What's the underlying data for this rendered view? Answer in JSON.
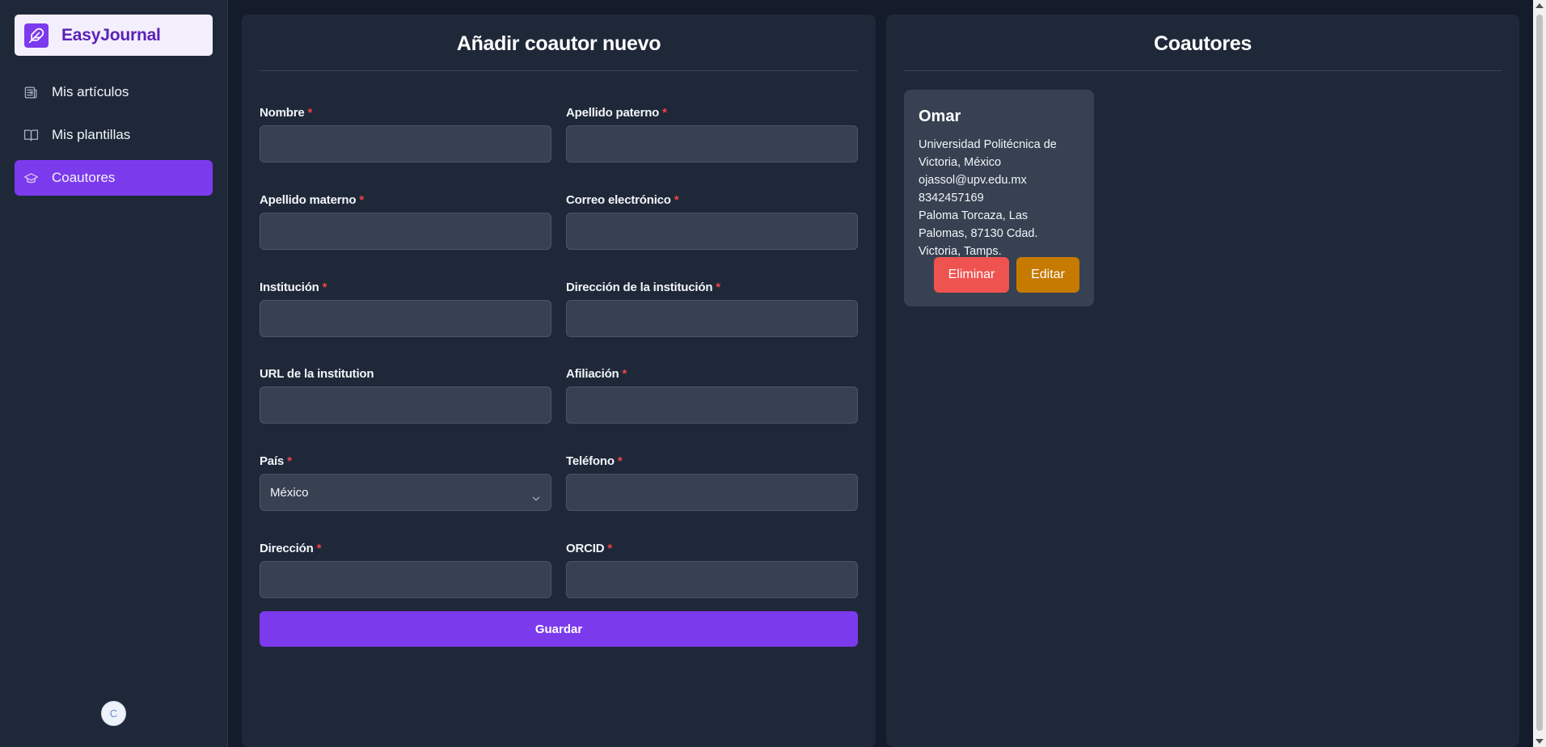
{
  "brand": {
    "name": "EasyJournal",
    "accent": "#7c3aed"
  },
  "sidebar": {
    "items": [
      {
        "label": "Mis artículos",
        "icon": "newspaper-icon",
        "active": false
      },
      {
        "label": "Mis plantillas",
        "icon": "book-open-icon",
        "active": false
      },
      {
        "label": "Coautores",
        "icon": "graduation-cap-icon",
        "active": true
      }
    ],
    "user_initial": "C"
  },
  "form": {
    "title": "Añadir coautor nuevo",
    "fields": {
      "nombre": {
        "label": "Nombre",
        "required": true,
        "value": ""
      },
      "apellido_paterno": {
        "label": "Apellido paterno",
        "required": true,
        "value": ""
      },
      "apellido_materno": {
        "label": "Apellido materno",
        "required": true,
        "value": ""
      },
      "correo": {
        "label": "Correo electrónico",
        "required": true,
        "value": ""
      },
      "institucion": {
        "label": "Institución",
        "required": true,
        "value": ""
      },
      "direccion_institucion": {
        "label": "Dirección de la institución",
        "required": true,
        "value": ""
      },
      "url_institucion": {
        "label": "URL de la institution",
        "required": false,
        "value": ""
      },
      "afiliacion": {
        "label": "Afiliación",
        "required": true,
        "value": ""
      },
      "pais": {
        "label": "País",
        "required": true,
        "value": "México"
      },
      "telefono": {
        "label": "Teléfono",
        "required": true,
        "value": ""
      },
      "direccion": {
        "label": "Dirección",
        "required": true,
        "value": ""
      },
      "orcid": {
        "label": "ORCID",
        "required": true,
        "value": ""
      }
    },
    "required_mark": "*",
    "save_label": "Guardar"
  },
  "coauthors": {
    "title": "Coautores",
    "cards": [
      {
        "name": "Omar",
        "institution": "Universidad Politécnica de Victoria, México",
        "email": "ojassol@upv.edu.mx",
        "phone": "8342457169",
        "address": "Paloma Torcaza, Las Palomas, 87130 Cdad. Victoria, Tamps.",
        "delete_label": "Eliminar",
        "edit_label": "Editar"
      }
    ]
  },
  "colors": {
    "background": "#141c2b",
    "panel": "#1f2838",
    "input": "#374151",
    "required": "#ef4444",
    "delete": "#ef5350",
    "edit": "#c77a00"
  }
}
